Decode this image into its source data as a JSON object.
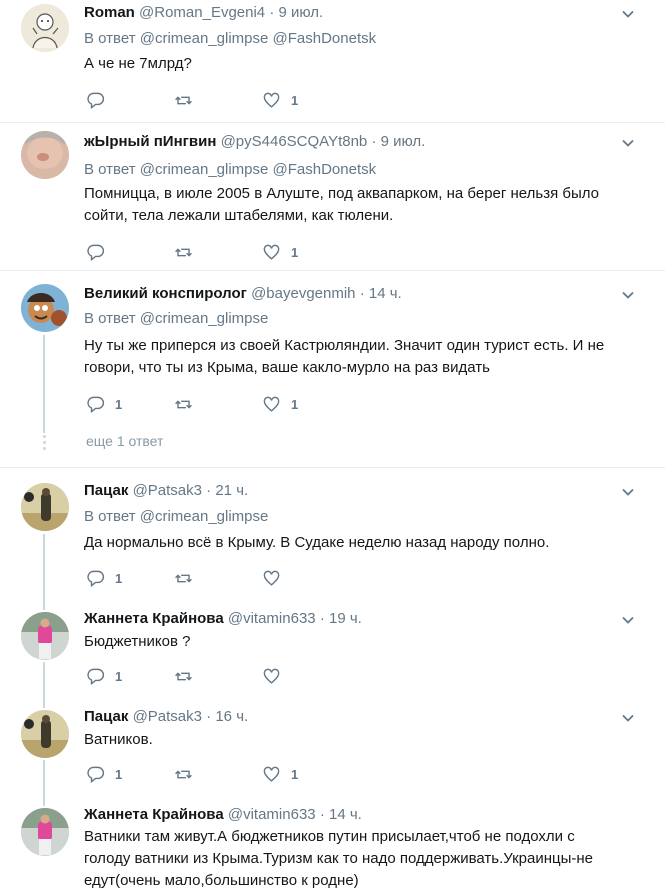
{
  "reply_prefix": "В ответ",
  "more_replies": "еще 1 ответ",
  "tweets": [
    {
      "name": "Roman",
      "handle": "@Roman_Evgeni4",
      "dot": "·",
      "time": "9 июл.",
      "reply_mentions": "@crimean_glimpse @FashDonetsk",
      "text": "А че не 7млрд?",
      "replies": "",
      "likes": "1"
    },
    {
      "name": "жЫрный пИнгвин",
      "handle": "@pyS446SCQAYt8nb",
      "dot": "·",
      "time": "9 июл.",
      "reply_mentions": "@crimean_glimpse @FashDonetsk",
      "text": "Помницца, в июле 2005 в Алуште, под аквапарком, на берег нельзя было сойти, тела лежали штабелями, как тюлени.",
      "replies": "",
      "likes": "1"
    },
    {
      "name": "Великий конспиролог",
      "handle": "@bayevgenmih",
      "dot": "·",
      "time": "14 ч.",
      "reply_mentions": "@crimean_glimpse",
      "text": "Ну ты же приперся из своей Кастрюляндии. Значит один турист есть. И не говори, что ты из Крыма,  ваше какло-мурло на раз видать",
      "replies": "1",
      "likes": "1"
    },
    {
      "name": "Пацак",
      "handle": "@Patsak3",
      "dot": "·",
      "time": "21 ч.",
      "reply_mentions": "@crimean_glimpse",
      "text": "Да нормально всё в Крыму. В Судаке неделю назад народу полно.",
      "replies": "1",
      "likes": ""
    },
    {
      "name": "Жаннета Крайнова",
      "handle": "@vitamin633",
      "dot": "·",
      "time": "19 ч.",
      "text": "Бюджетников ?",
      "replies": "1",
      "likes": ""
    },
    {
      "name": "Пацак",
      "handle": "@Patsak3",
      "dot": "·",
      "time": "16 ч.",
      "text": "Ватников.",
      "replies": "1",
      "likes": "1"
    },
    {
      "name": "Жаннета Крайнова",
      "handle": "@vitamin633",
      "dot": "·",
      "time": "14 ч.",
      "text": "Ватники там живут.А бюджетников путин присылает,чтоб не подохли с голоду ватники из Крыма.Туризм как то надо поддерживать.Украинцы-не едут(очень мало,большинство к родне)"
    }
  ]
}
